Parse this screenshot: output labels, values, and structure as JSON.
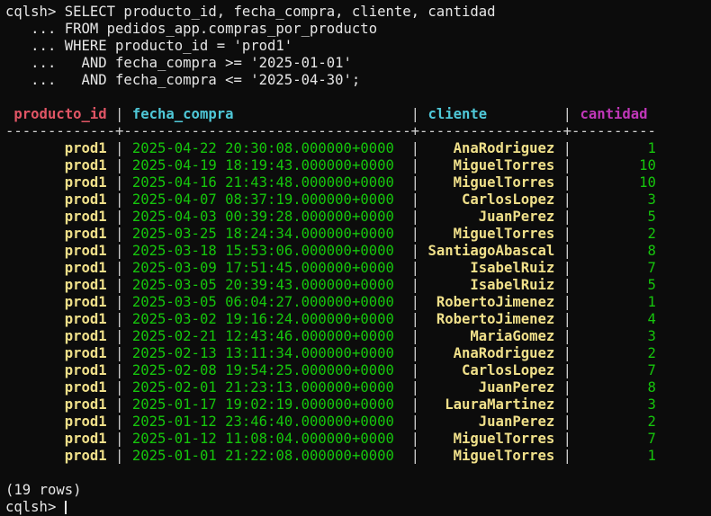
{
  "prompt": "cqlsh> ",
  "query_lines": [
    "SELECT producto_id, fecha_compra, cliente, cantidad",
    "   ... FROM pedidos_app.compras_por_producto",
    "   ... WHERE producto_id = 'prod1'",
    "   ...   AND fecha_compra >= '2025-01-01'",
    "   ...   AND fecha_compra <= '2025-04-30';"
  ],
  "columns": [
    "producto_id",
    "fecha_compra",
    "cliente",
    "cantidad"
  ],
  "rows": [
    [
      "prod1",
      "2025-04-22 20:30:08.000000+0000",
      "AnaRodriguez",
      "1"
    ],
    [
      "prod1",
      "2025-04-19 18:19:43.000000+0000",
      "MiguelTorres",
      "10"
    ],
    [
      "prod1",
      "2025-04-16 21:43:48.000000+0000",
      "MiguelTorres",
      "10"
    ],
    [
      "prod1",
      "2025-04-07 08:37:19.000000+0000",
      "CarlosLopez",
      "3"
    ],
    [
      "prod1",
      "2025-04-03 00:39:28.000000+0000",
      "JuanPerez",
      "5"
    ],
    [
      "prod1",
      "2025-03-25 18:24:34.000000+0000",
      "MiguelTorres",
      "2"
    ],
    [
      "prod1",
      "2025-03-18 15:53:06.000000+0000",
      "SantiagoAbascal",
      "8"
    ],
    [
      "prod1",
      "2025-03-09 17:51:45.000000+0000",
      "IsabelRuiz",
      "7"
    ],
    [
      "prod1",
      "2025-03-05 20:39:43.000000+0000",
      "IsabelRuiz",
      "5"
    ],
    [
      "prod1",
      "2025-03-05 06:04:27.000000+0000",
      "RobertoJimenez",
      "1"
    ],
    [
      "prod1",
      "2025-03-02 19:16:24.000000+0000",
      "RobertoJimenez",
      "4"
    ],
    [
      "prod1",
      "2025-02-21 12:43:46.000000+0000",
      "MariaGomez",
      "3"
    ],
    [
      "prod1",
      "2025-02-13 13:11:34.000000+0000",
      "AnaRodriguez",
      "2"
    ],
    [
      "prod1",
      "2025-02-08 19:54:25.000000+0000",
      "CarlosLopez",
      "7"
    ],
    [
      "prod1",
      "2025-02-01 21:23:13.000000+0000",
      "JuanPerez",
      "8"
    ],
    [
      "prod1",
      "2025-01-17 19:02:19.000000+0000",
      "LauraMartinez",
      "3"
    ],
    [
      "prod1",
      "2025-01-12 23:46:40.000000+0000",
      "JuanPerez",
      "2"
    ],
    [
      "prod1",
      "2025-01-12 11:08:04.000000+0000",
      "MiguelTorres",
      "7"
    ],
    [
      "prod1",
      "2025-01-01 21:22:08.000000+0000",
      "MiguelTorres",
      "1"
    ]
  ],
  "result_summary": "(19 rows)",
  "colors": {
    "background": "#0c0c0c",
    "header_producto_id": "#e05565",
    "header_fecha_compra": "#4fc8d8",
    "header_cliente": "#4fc8d8",
    "header_cantidad": "#c037b8",
    "text_key": "#f0e08a",
    "text_value": "#16c60c"
  }
}
